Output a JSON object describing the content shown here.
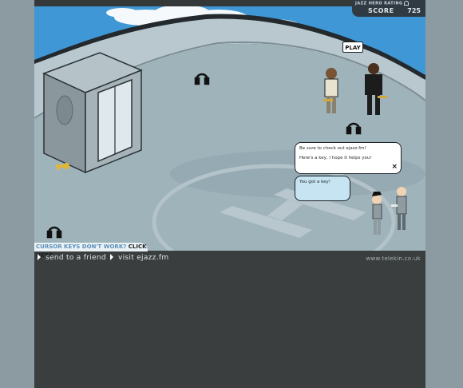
{
  "score_panel": {
    "title": "JAZZ HERO RATING",
    "label": "SCORE",
    "value": "725"
  },
  "scene": {
    "play_label": "PLAY",
    "chat": {
      "main_line1": "Be sure to check out ejazz.fm!",
      "main_line2": "Here's a key, I hope it helps you!",
      "close_glyph": "×",
      "reply": "You got a key!"
    },
    "icons": [
      "headphones-icon",
      "headphones-icon",
      "headphones-icon",
      "key-icon"
    ],
    "colors": {
      "sky": "#3f97d6",
      "roof": "#9fb3bb",
      "roof_dark": "#8fa3ab",
      "ui_dark": "#3a3e3e"
    }
  },
  "banner": {
    "question": "CURSOR KEYS DON'T WORK?",
    "link": "CLICK HERE"
  },
  "footer": {
    "send_label": "send to a friend",
    "visit_label": "visit ejazz.fm",
    "credit": "www.telekin.co.uk"
  }
}
